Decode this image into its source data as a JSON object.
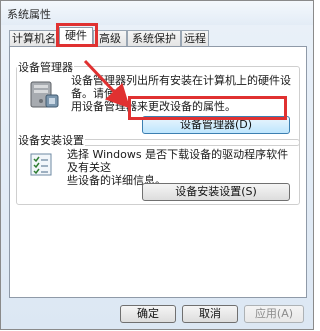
{
  "window": {
    "title": "系统属性"
  },
  "tabs": [
    {
      "label": "计算机名"
    },
    {
      "label": "硬件"
    },
    {
      "label": "高级"
    },
    {
      "label": "系统保护"
    },
    {
      "label": "远程"
    }
  ],
  "device_manager": {
    "title": "设备管理器",
    "description_lines": [
      "设备管理器列出所有安装在计算机上的硬件设备。请使",
      "用设备管理器来更改设备的属性。"
    ],
    "button_label": "设备管理器(D)"
  },
  "device_install": {
    "title": "设备安装设置",
    "description_lines": [
      "选择 Windows 是否下载设备的驱动程序软件及有关这",
      "些设备的详细信息。"
    ],
    "button_label": "设备安装设置(S)"
  },
  "footer": {
    "ok_label": "确定",
    "cancel_label": "取消",
    "apply_label": "应用(A)"
  },
  "colors": {
    "annotation_red": "#e03131",
    "window_background": "#dce7f3"
  },
  "icons": {
    "device_manager": "computer-hardware-icon",
    "device_install": "checklist-settings-icon"
  }
}
